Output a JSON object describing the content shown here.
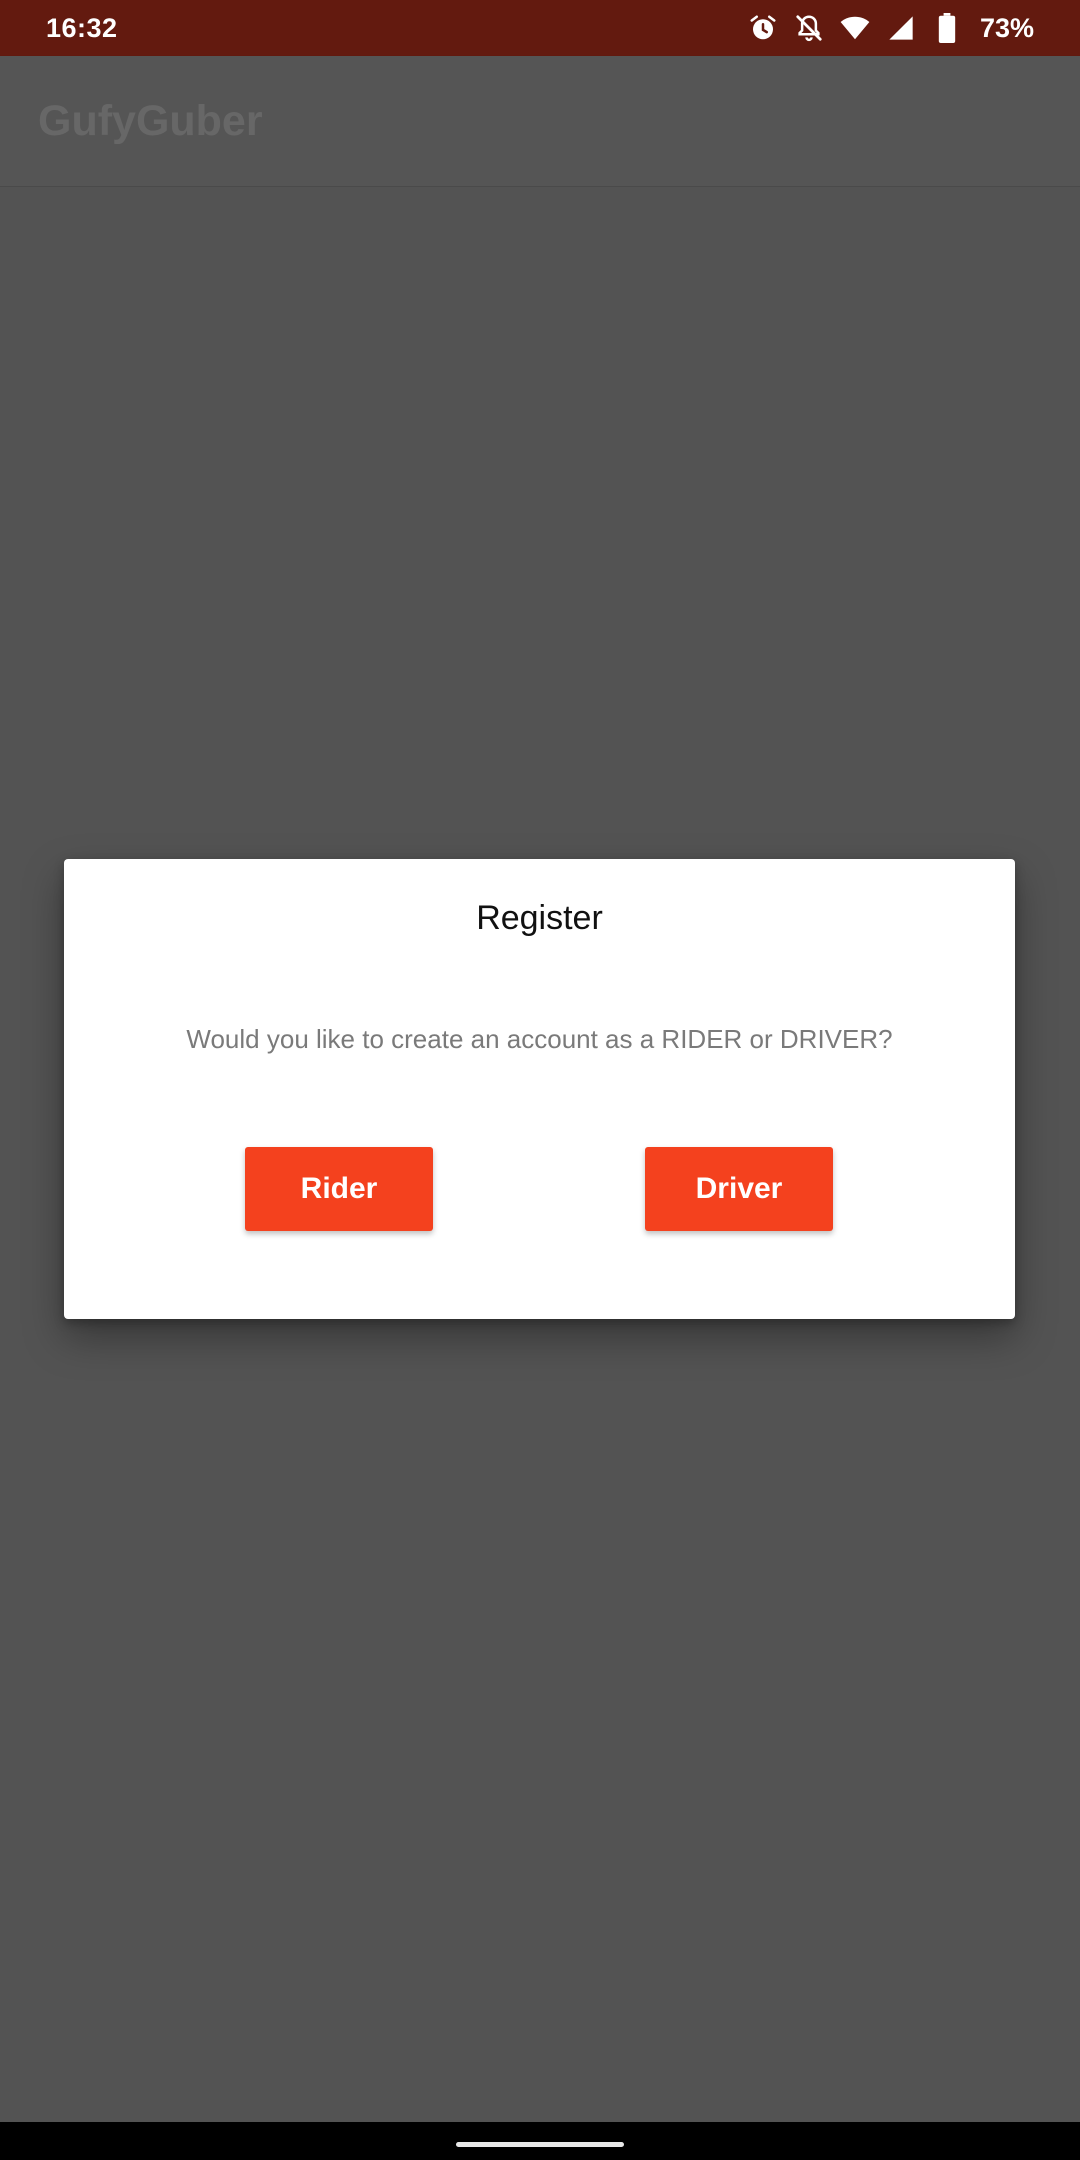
{
  "status_bar": {
    "time": "16:32",
    "icons": [
      "alarm-icon",
      "notifications-off-icon",
      "wifi-icon",
      "signal-icon",
      "battery-icon"
    ],
    "battery_percent": "73%"
  },
  "app_bar": {
    "title": "GufyGuber"
  },
  "dialog": {
    "title": "Register",
    "message": "Would you like to create an account as a RIDER or DRIVER?",
    "buttons": {
      "rider_label": "Rider",
      "driver_label": "Driver"
    }
  },
  "colors": {
    "status_bar": "#631a0f",
    "accent": "#f4411e",
    "scrim_background": "#535353"
  }
}
